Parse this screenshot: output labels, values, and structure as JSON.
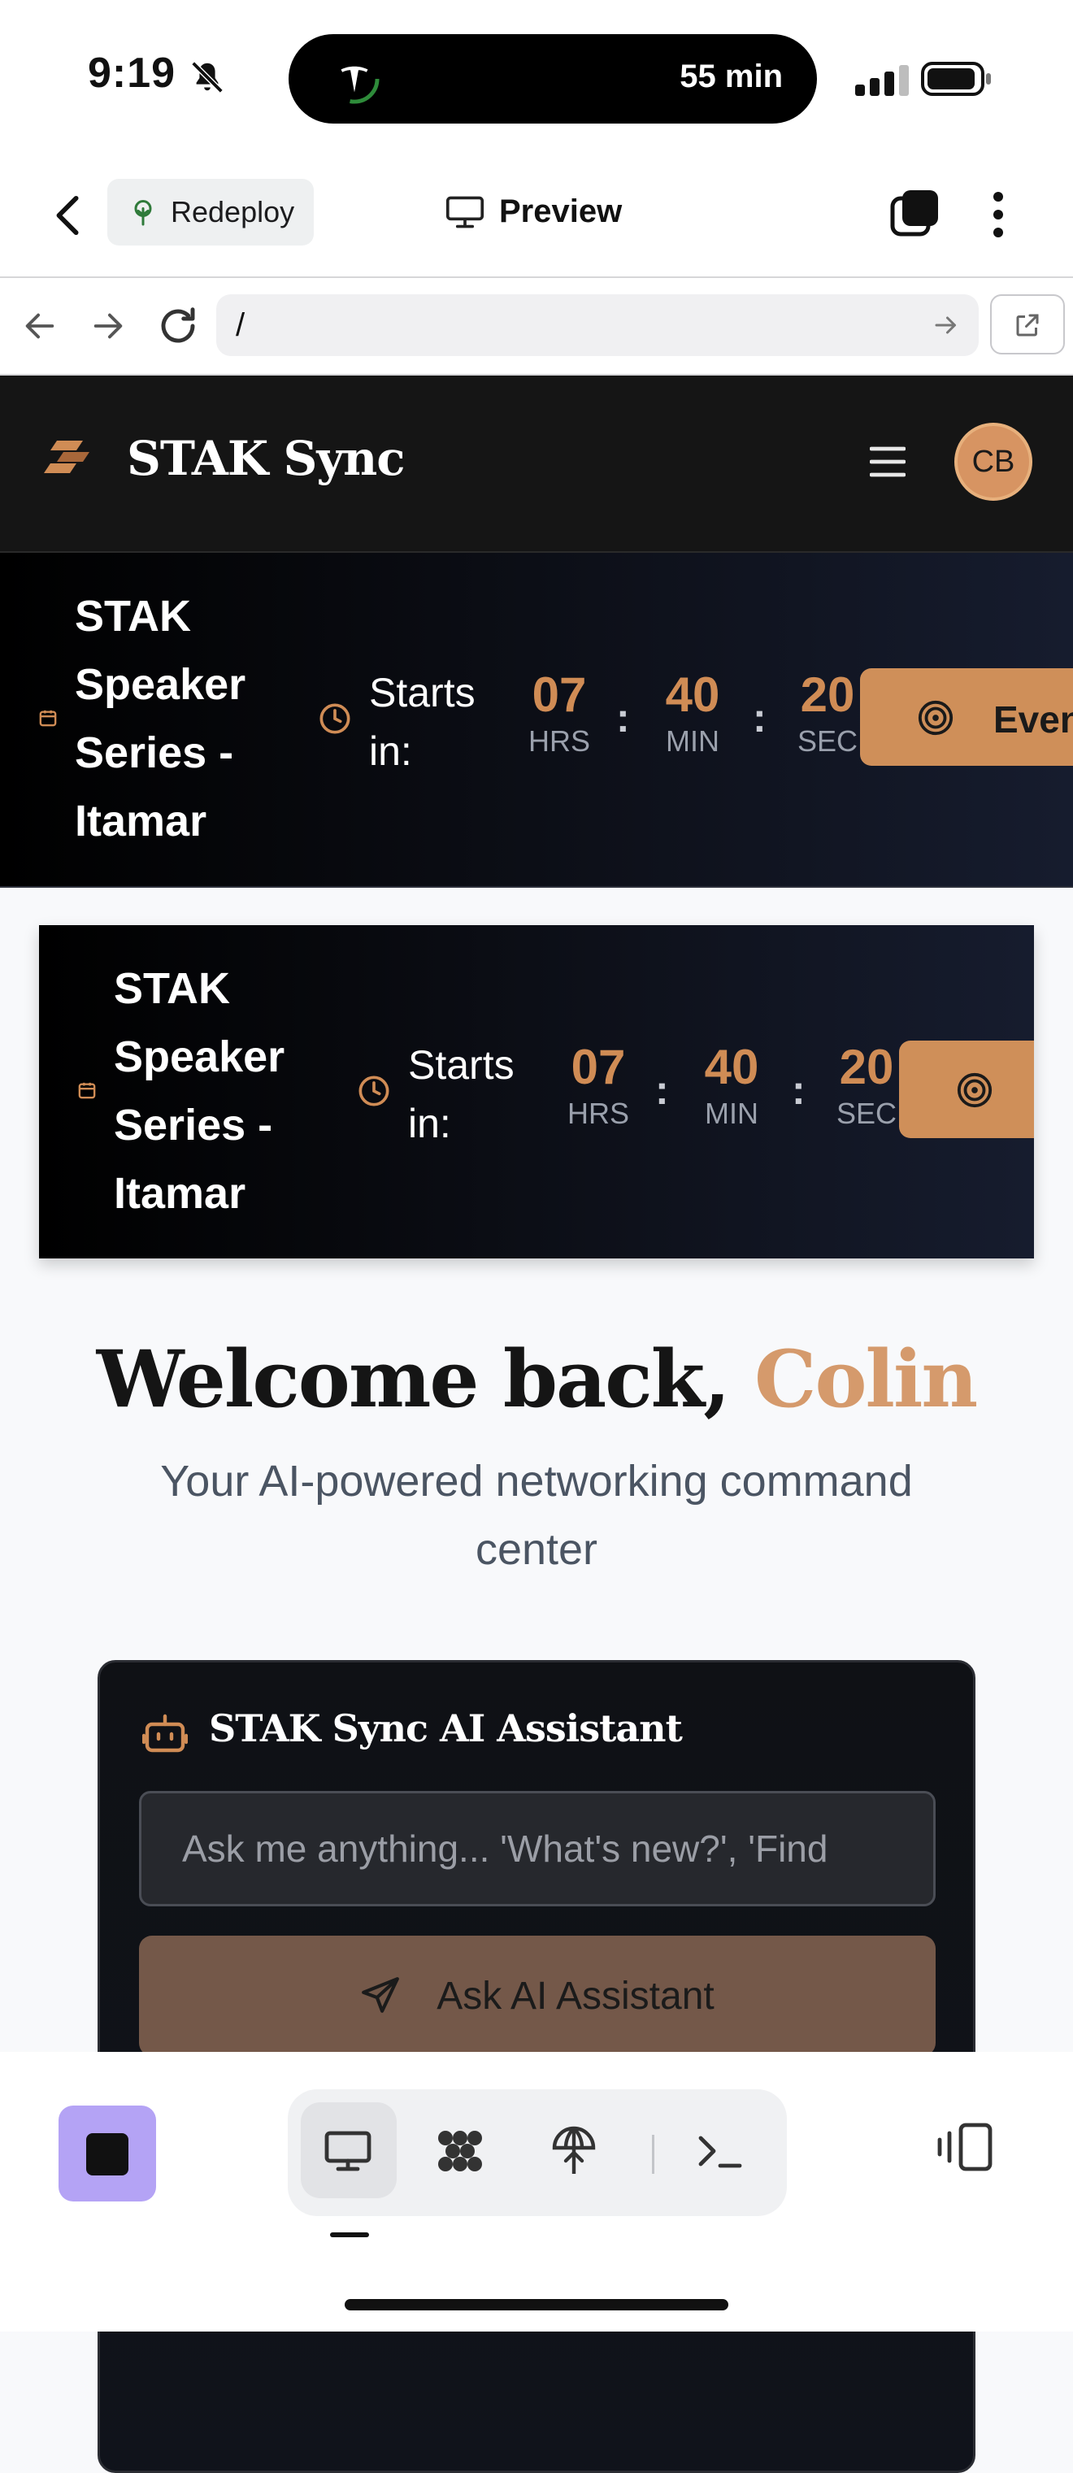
{
  "status_bar": {
    "time": "9:19",
    "activity_duration": "55 min",
    "icons": [
      "bell-slash-icon",
      "tesla-logo-icon",
      "cellular-signal-icon",
      "battery-icon"
    ]
  },
  "app_toolbar": {
    "redeploy_label": "Redeploy",
    "preview_label": "Preview"
  },
  "browser": {
    "url": "/"
  },
  "site": {
    "brand": "STAK Sync",
    "avatar_initials": "CB",
    "accent_color": "#d08c55"
  },
  "event_banner": {
    "title": "STAK Speaker Series - Itamar",
    "starts_in_label": "Starts in:",
    "countdown": [
      {
        "value": "07",
        "unit": "HRS"
      },
      {
        "value": "40",
        "unit": "MIN"
      },
      {
        "value": "20",
        "unit": "SEC"
      }
    ],
    "button_label": "Even",
    "button_label_clipped": "Ev"
  },
  "welcome": {
    "greeting": "Welcome back,",
    "name": "Colin",
    "subtitle": "Your AI-powered networking command center"
  },
  "assistant": {
    "title": "STAK Sync AI Assistant",
    "input_placeholder": "Ask me anything... 'What's new?', 'Find",
    "button_label": "Ask AI Assistant"
  },
  "bottom_bar": {
    "tabs": [
      "desktop-icon",
      "apps-grid-icon",
      "globe-icon",
      "terminal-icon"
    ],
    "active_tab": "desktop-icon"
  }
}
